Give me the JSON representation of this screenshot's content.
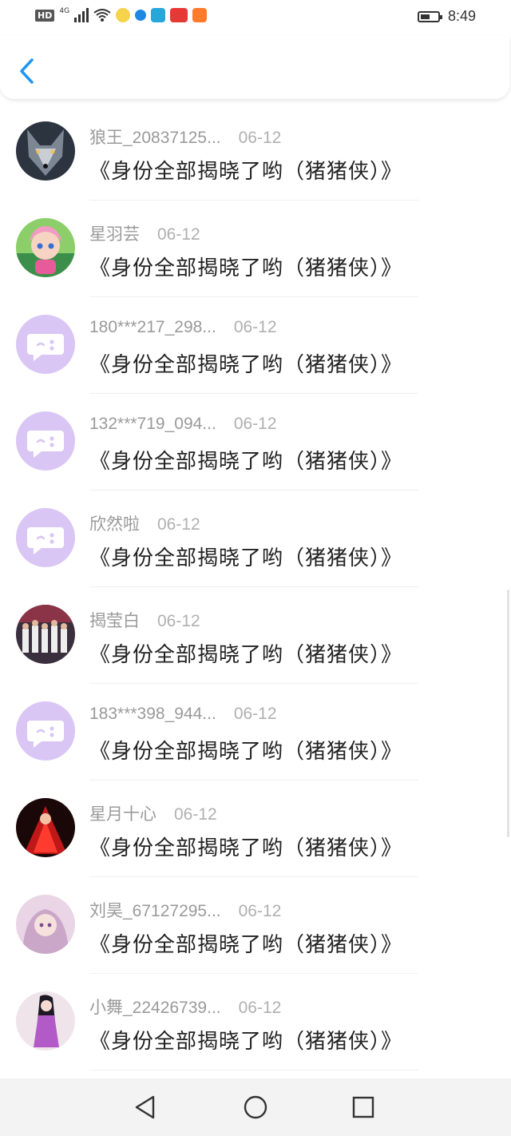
{
  "status": {
    "left_badges": [
      "HD",
      "4G"
    ],
    "time": "8:49",
    "battery_level": 0.55,
    "icons": [
      "signal-icon",
      "wifi-icon",
      "app-icon-1",
      "app-icon-2",
      "app-icon-3",
      "toutiao-icon",
      "app-icon-5"
    ]
  },
  "header": {
    "back_icon": "chevron-left-icon"
  },
  "items": [
    {
      "user": "狼王_20837125...",
      "date": "06-12",
      "title": "《身份全部揭晓了哟（猪猪侠）》",
      "avatar": "wolf-photo"
    },
    {
      "user": "星羽芸",
      "date": "06-12",
      "title": "《身份全部揭晓了哟（猪猪侠）》",
      "avatar": "cartoon-girl"
    },
    {
      "user": "180***217_298...",
      "date": "06-12",
      "title": "《身份全部揭晓了哟（猪猪侠）》",
      "avatar": "default-chat"
    },
    {
      "user": "132***719_094...",
      "date": "06-12",
      "title": "《身份全部揭晓了哟（猪猪侠）》",
      "avatar": "default-chat"
    },
    {
      "user": "欣然啦",
      "date": "06-12",
      "title": "《身份全部揭晓了哟（猪猪侠）》",
      "avatar": "default-chat"
    },
    {
      "user": "揭莹白",
      "date": "06-12",
      "title": "《身份全部揭晓了哟（猪猪侠）》",
      "avatar": "group-photo"
    },
    {
      "user": "183***398_944...",
      "date": "06-12",
      "title": "《身份全部揭晓了哟（猪猪侠）》",
      "avatar": "default-chat"
    },
    {
      "user": "星月十心",
      "date": "06-12",
      "title": "《身份全部揭晓了哟（猪猪侠）》",
      "avatar": "red-character"
    },
    {
      "user": "刘昊_67127295...",
      "date": "06-12",
      "title": "《身份全部揭晓了哟（猪猪侠）》",
      "avatar": "anime-girl-pink"
    },
    {
      "user": "小舞_22426739...",
      "date": "06-12",
      "title": "《身份全部揭晓了哟（猪猪侠）》",
      "avatar": "anime-girl-dress"
    }
  ],
  "navbar": {
    "icons": [
      "back-triangle-icon",
      "home-circle-icon",
      "recents-square-icon"
    ]
  },
  "colors": {
    "accent": "#2196f3",
    "placeholder_avatar": "#d9c6f5",
    "username": "#9a9a9a"
  }
}
